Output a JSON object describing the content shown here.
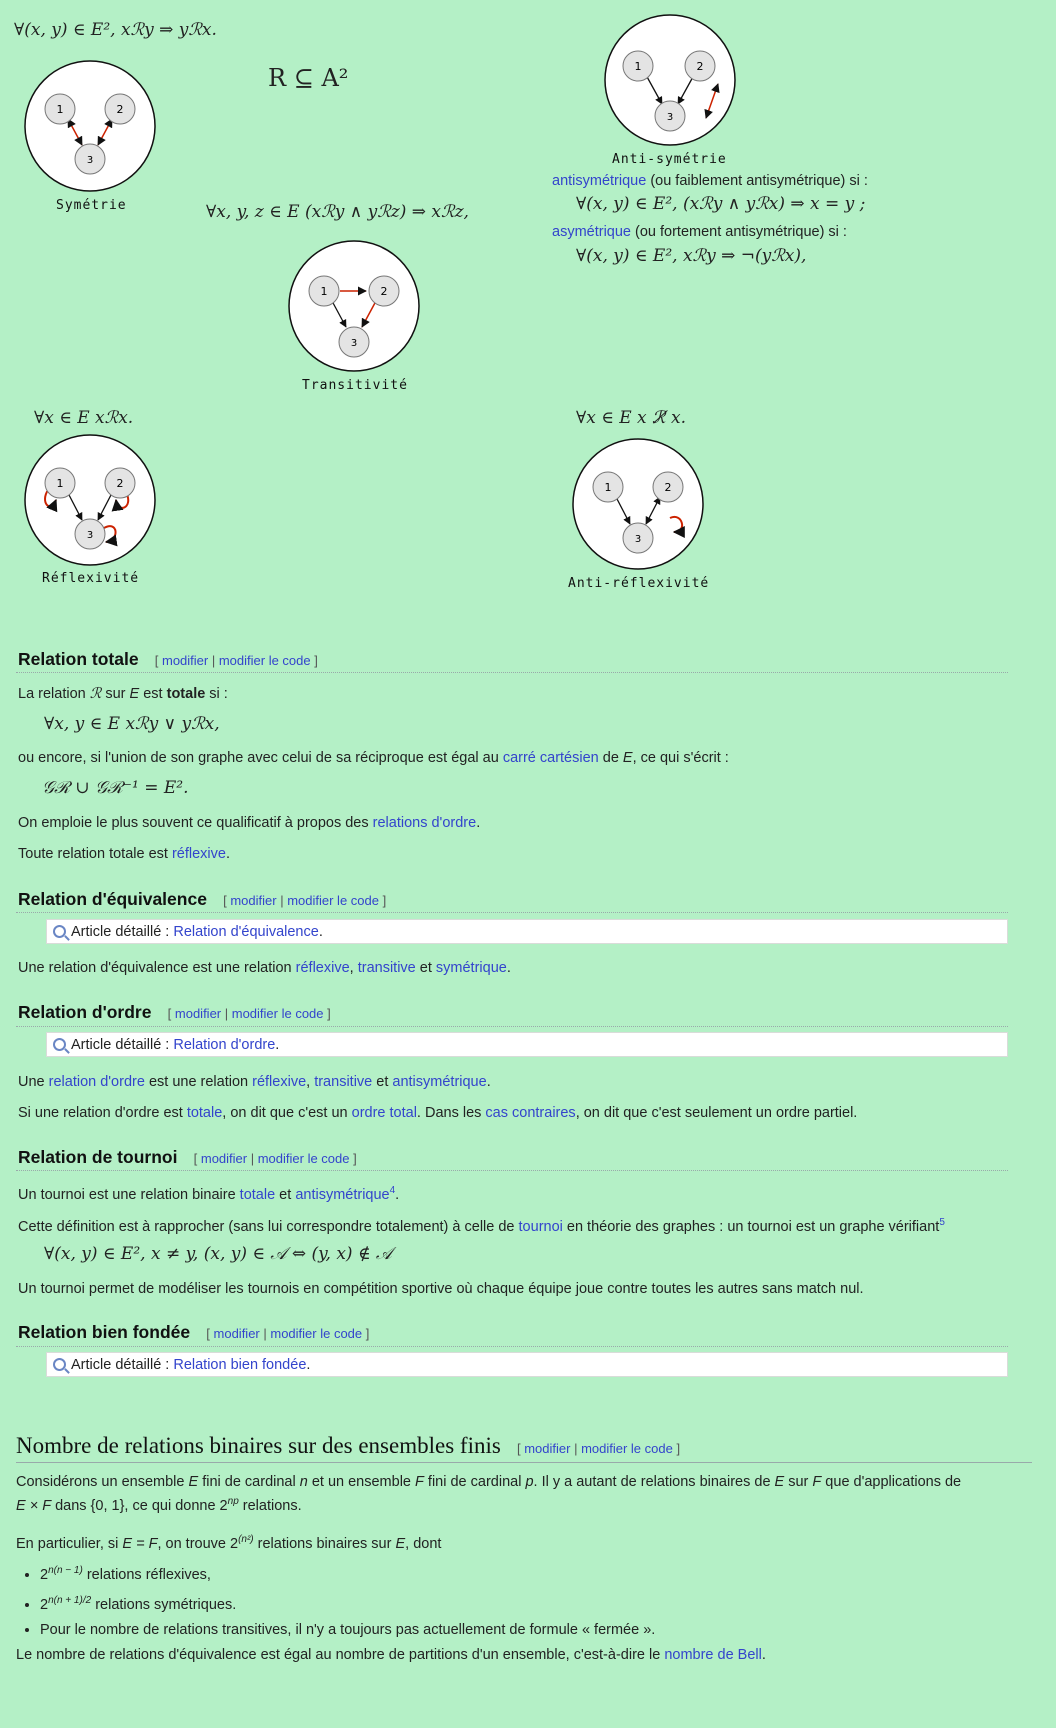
{
  "formulas": {
    "symmetry": "∀(x, y) ∈ E², xℛy ⇒ yℛx.",
    "subset": "R ⊆ A²",
    "transitivity": "∀x, y, z ∈ E   (xℛy ∧ yℛz) ⇒ xℛz,",
    "reflexivity": "∀x ∈ E   xℛx.",
    "antireflexivity": "∀x ∈ E   x ℛ̸ x.",
    "antisym_def": "∀(x, y) ∈ E², (xℛy ∧ yℛx) ⇒ x = y ;",
    "asym_def": "∀(x, y) ∈ E², xℛy ⇒ ¬(yℛx),"
  },
  "diagrams": {
    "symmetry_caption": "Symétrie",
    "antisymmetry_caption": "Anti-symétrie",
    "transitivity_caption": "Transitivité",
    "reflexivity_caption": "Réflexivité",
    "antireflexivity_caption": "Anti-réflexivité",
    "node_labels": [
      "1",
      "2",
      "3"
    ]
  },
  "antisym_text": {
    "link1": "antisymétrique",
    "text1": " (ou faiblement antisymétrique) si :",
    "link2": "asymétrique",
    "text2": " (ou fortement antisymétrique) si :"
  },
  "edit_links": {
    "open": "[ ",
    "modifier": "modifier",
    "sep": " | ",
    "modifier_code": "modifier le code",
    "close": " ]"
  },
  "detail_prefix": "Article détaillé : ",
  "totale": {
    "title": "Relation totale",
    "p1_a": "La relation ",
    "p1_R": "ℛ",
    "p1_b": " sur ",
    "p1_E": "E",
    "p1_c": " est ",
    "p1_bold": "totale",
    "p1_d": " si :",
    "formula1": "∀x, y ∈ E    xℛy ∨ yℛx,",
    "p2_a": "ou encore, si l'union de son graphe avec celui de sa réciproque est égal au ",
    "p2_link1": "carré",
    "p2_space": " ",
    "p2_link2": "cartésien",
    "p2_b": " de ",
    "p2_E": "E",
    "p2_c": ", ce qui s'écrit :",
    "formula2": "𝒢ℛ ∪ 𝒢ℛ⁻¹ = E².",
    "p3_a": "On emploie le plus souvent ce qualificatif à propos des ",
    "p3_link": "relations d'ordre",
    "p3_b": ".",
    "p4_a": "Toute relation totale est ",
    "p4_link": "réflexive",
    "p4_b": "."
  },
  "equivalence": {
    "title": "Relation d'équivalence",
    "detail_link": "Relation d'équivalence",
    "detail_end": ".",
    "p1_a": "Une relation d'équivalence est une relation ",
    "link1": "réflexive",
    "comma": ", ",
    "link2": "transitive",
    "et": " et ",
    "link3": "symétrique",
    "end": "."
  },
  "ordre": {
    "title": "Relation d'ordre",
    "detail_link": "Relation d'ordre",
    "detail_end": ".",
    "p1_a": "Une ",
    "p1_link0": "relation d'ordre",
    "p1_b": " est une relation ",
    "link1": "réflexive",
    "comma": ", ",
    "link2": "transitive",
    "et": " et ",
    "link3": "antisymétrique",
    "end": ".",
    "p2_a": "Si une relation d'ordre est ",
    "p2_link1": "totale",
    "p2_b": ", on dit que c'est un ",
    "p2_link2": "ordre total",
    "p2_c": ". Dans les ",
    "p2_link3": "cas contraires",
    "p2_d": ", on dit que c'est seulement un ordre partiel."
  },
  "tournoi": {
    "title": "Relation de tournoi",
    "p1_a": "Un tournoi est une relation binaire ",
    "p1_link1": "totale",
    "p1_et": " et ",
    "p1_link2": "antisymétrique",
    "p1_ref": "4",
    "p1_end": ".",
    "p2_a": "Cette définition est à rapprocher (sans lui correspondre totalement) à celle de ",
    "p2_link": "tournoi",
    "p2_b": " en théorie des graphes : un tournoi est un graphe vérifiant",
    "p2_ref": "5",
    "formula": "∀(x, y) ∈ E², x ≠ y, (x, y) ∈ 𝒜 ⇔ (y, x) ∉ 𝒜",
    "p3": "Un tournoi permet de modéliser les tournois en compétition sportive où chaque équipe joue contre toutes les autres sans match nul."
  },
  "fondee": {
    "title": "Relation bien fondée",
    "detail_link": "Relation bien fondée",
    "detail_end": "."
  },
  "nombre": {
    "title": "Nombre de relations binaires sur des ensembles finis",
    "p1_a": "Considérons un ensemble ",
    "E": "E",
    "p1_b": " fini de cardinal ",
    "n": "n",
    "p1_c": " et un ensemble ",
    "F": "F",
    "p1_d": " fini de cardinal ",
    "p": "p",
    "p1_e": ". Il y a autant de relations binaires de ",
    "p1_f": " sur ",
    "p1_g": " que d'applications de",
    "p1_h": "E × F",
    "p1_i": " dans {0, 1}, ce qui donne 2",
    "p1_sup": "np",
    "p1_j": " relations.",
    "p2_a": "En particulier, si ",
    "p2_eq": "E = F",
    "p2_b": ", on trouve 2",
    "p2_sup": "(n²)",
    "p2_c": " relations binaires sur ",
    "p2_E": "E",
    "p2_d": ", dont",
    "b1_base": "2",
    "b1_sup": "n(n − 1)",
    "b1_text": " relations réflexives,",
    "b2_base": "2",
    "b2_sup": "n(n + 1)/2",
    "b2_text": " relations symétriques.",
    "b3_text": "Pour le nombre de relations transitives, il n'y a toujours pas actuellement de formule « fermée ».",
    "p3_a": "Le nombre de relations d'équivalence est égal au nombre de partitions d'un ensemble, c'est-à-dire le ",
    "p3_link": "nombre de Bell",
    "p3_b": "."
  },
  "colors": {
    "background": "#b4f0c6",
    "link": "#3344cc",
    "arrow_red": "#cc2200",
    "node_fill": "#e4e4e4"
  }
}
